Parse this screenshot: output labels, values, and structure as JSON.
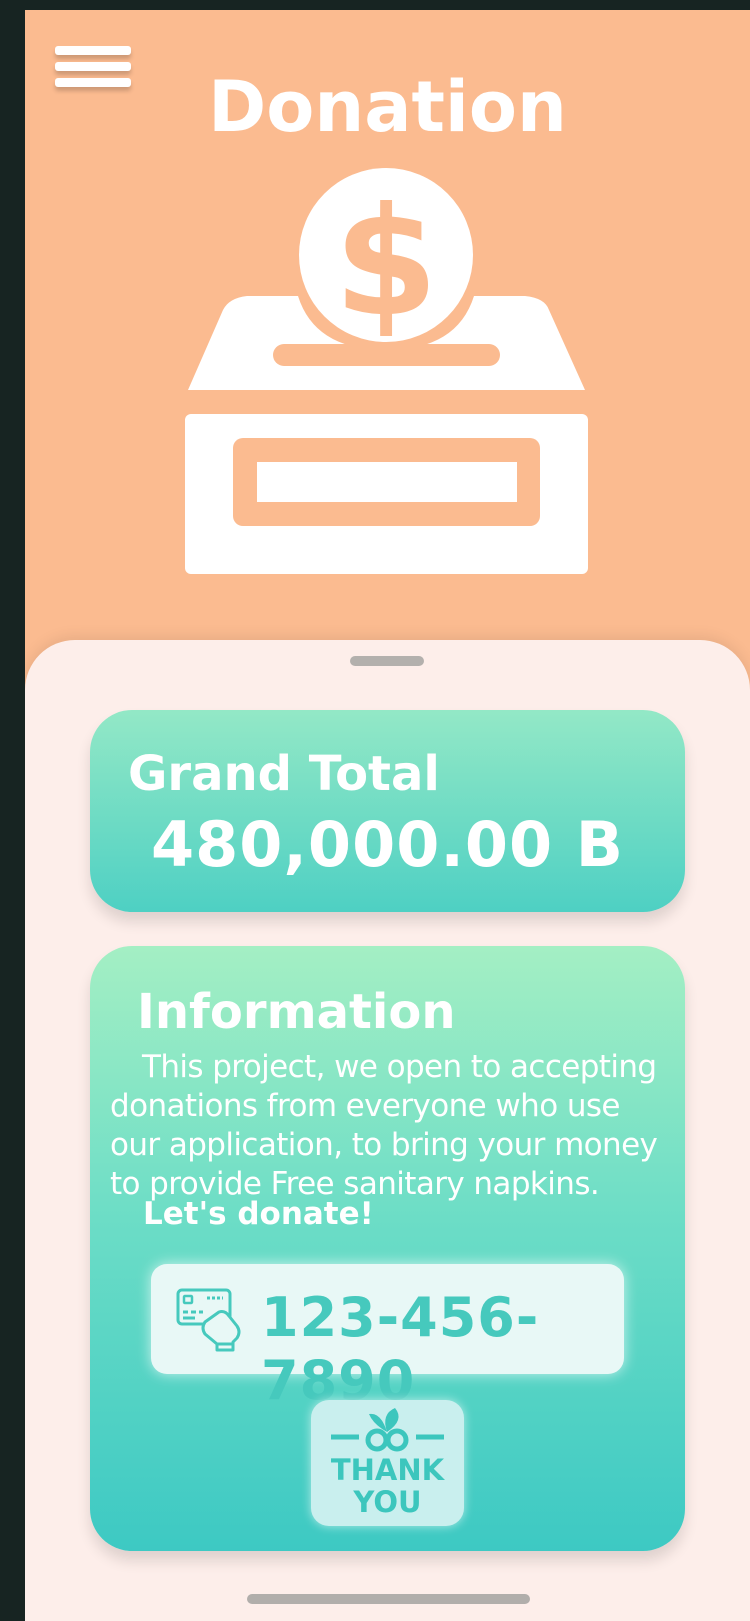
{
  "header": {
    "menu_icon": "hamburger-menu-icon",
    "title": "Donation"
  },
  "hero": {
    "icon": "donation-box-icon",
    "colors": {
      "background": "#fbbb90",
      "icon": "#ffffff"
    }
  },
  "grand_total": {
    "label": "Grand Total",
    "value": "480,000.00 B"
  },
  "information": {
    "title": "Information",
    "body": "This project, we open to accepting donations from everyone who use our application, to bring your money to provide Free sanitary napkins.",
    "cta": "Let's donate!",
    "account": {
      "icon": "credit-card-hand-icon",
      "number": "123-456-7890"
    },
    "thank_you_badge": {
      "icon": "flower-icon",
      "text": "THANK YOU"
    }
  },
  "colors": {
    "accent": "#46c9bd",
    "card_gradient_top": "#a4efc4",
    "card_gradient_bottom": "#3dc9c3",
    "sheet": "#fdeeea"
  }
}
